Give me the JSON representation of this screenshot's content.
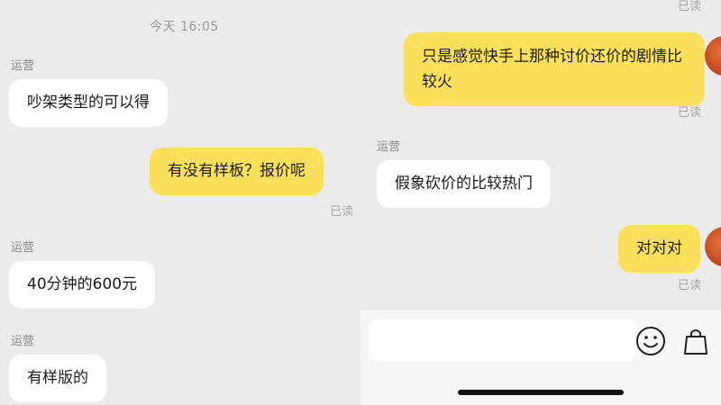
{
  "left_panel": {
    "timestamp": "今天 16:05",
    "messages": [
      {
        "sender": "运营",
        "text": "吵架类型的可以得"
      },
      {
        "text": "有没有样板？报价呢",
        "status": "已读"
      },
      {
        "sender": "运营",
        "text": "40分钟的600元"
      },
      {
        "sender": "运营",
        "text": "有样版的"
      }
    ]
  },
  "right_panel": {
    "top_status": "已读",
    "messages": [
      {
        "text": "只是感觉快手上那种讨价还价的剧情比较火",
        "status": "已读"
      },
      {
        "sender": "运营",
        "text": "假象砍价的比较热门"
      },
      {
        "text": "对对对",
        "status": "已读"
      }
    ]
  },
  "colors": {
    "own_bubble": "#fbe15b",
    "other_bubble": "#ffffff",
    "background": "#ebebeb"
  },
  "icons": {
    "emoji": "smiley-face-icon",
    "more": "shopping-bag-icon"
  }
}
